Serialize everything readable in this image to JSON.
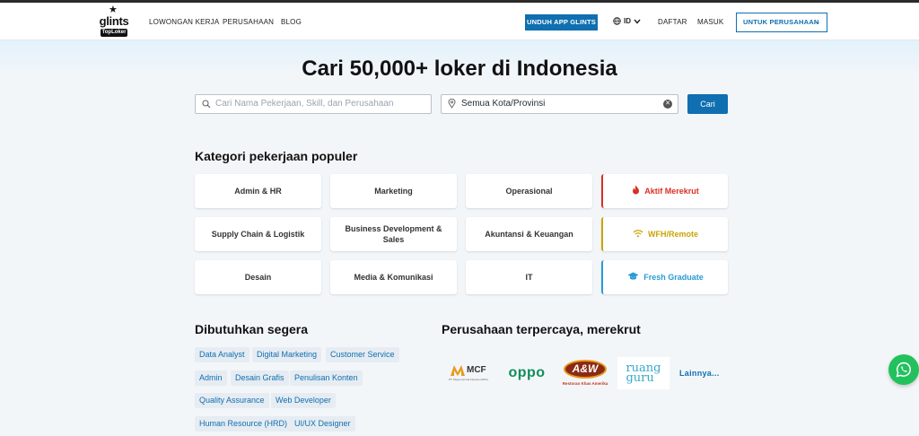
{
  "brand": {
    "logo_word": "glints",
    "logo_badge": "TopLoker"
  },
  "nav": {
    "links": [
      "LOWONGAN KERJA",
      "PERUSAHAAN",
      "BLOG"
    ],
    "app_button": "UNDUH APP GLINTS",
    "lang": "ID",
    "register": "DAFTAR",
    "login": "MASUK",
    "company_button": "UNTUK PERUSAHAAN"
  },
  "hero": {
    "title": "Cari 50,000+ loker di Indonesia",
    "search_placeholder": "Cari Nama Pekerjaan, Skill, dan Perusahaan",
    "location_value": "Semua Kota/Provinsi",
    "search_button": "Cari"
  },
  "categories": {
    "title": "Kategori pekerjaan populer",
    "items": [
      "Admin & HR",
      "Marketing",
      "Operasional",
      "Aktif Merekrut",
      "Supply Chain & Logistik",
      "Business Development & Sales",
      "Akuntansi & Keuangan",
      "WFH/Remote",
      "Desain",
      "Media & Komunikasi",
      "IT",
      "Fresh Graduate"
    ],
    "colors": {
      "aktif": "#d93025",
      "wfh": "#c9a400",
      "fresh": "#2a9bd6"
    }
  },
  "urgent": {
    "title": "Dibutuhkan segera",
    "tags": [
      "Data Analyst",
      "Digital Marketing",
      "Customer Service",
      "Admin",
      "Desain Grafis",
      "Penulisan Konten",
      "Quality Assurance",
      "Web Developer",
      "Human Resource (HRD)",
      "UI/UX Designer"
    ]
  },
  "companies": {
    "title": "Perusahaan terpercaya, merekrut",
    "logos": {
      "mcf": "MCF",
      "mcf_sub": "PT. Mega Central Finance (MCF)",
      "oppo": "oppo",
      "aw": "A&W",
      "aw_sub": "Restoran Khas Amerika",
      "ruangguru_1": "ruang",
      "ruangguru_2": "guru"
    },
    "more": "Lainnya..."
  },
  "colors": {
    "primary": "#0f6fb0",
    "whatsapp": "#22c15e"
  }
}
